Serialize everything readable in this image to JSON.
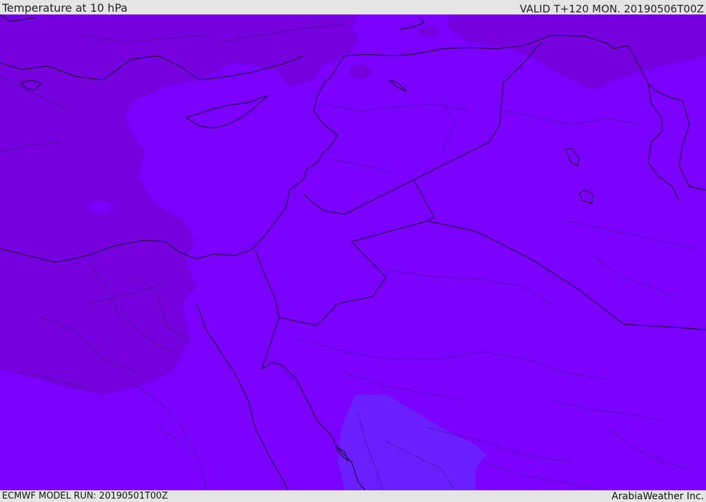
{
  "header": {
    "title": "Temperature at 10 hPa",
    "valid": "VALID T+120 MON. 20190506T00Z"
  },
  "footer": {
    "model_run": "ECMWF MODEL RUN: 20190501T00Z",
    "brand": "ArabiaWeather Inc."
  },
  "map": {
    "colors": {
      "base": "#7a00ff",
      "cool_band": "#7300dd",
      "warm_patch": "#6a1fff",
      "coastline": "#1a0033"
    }
  }
}
